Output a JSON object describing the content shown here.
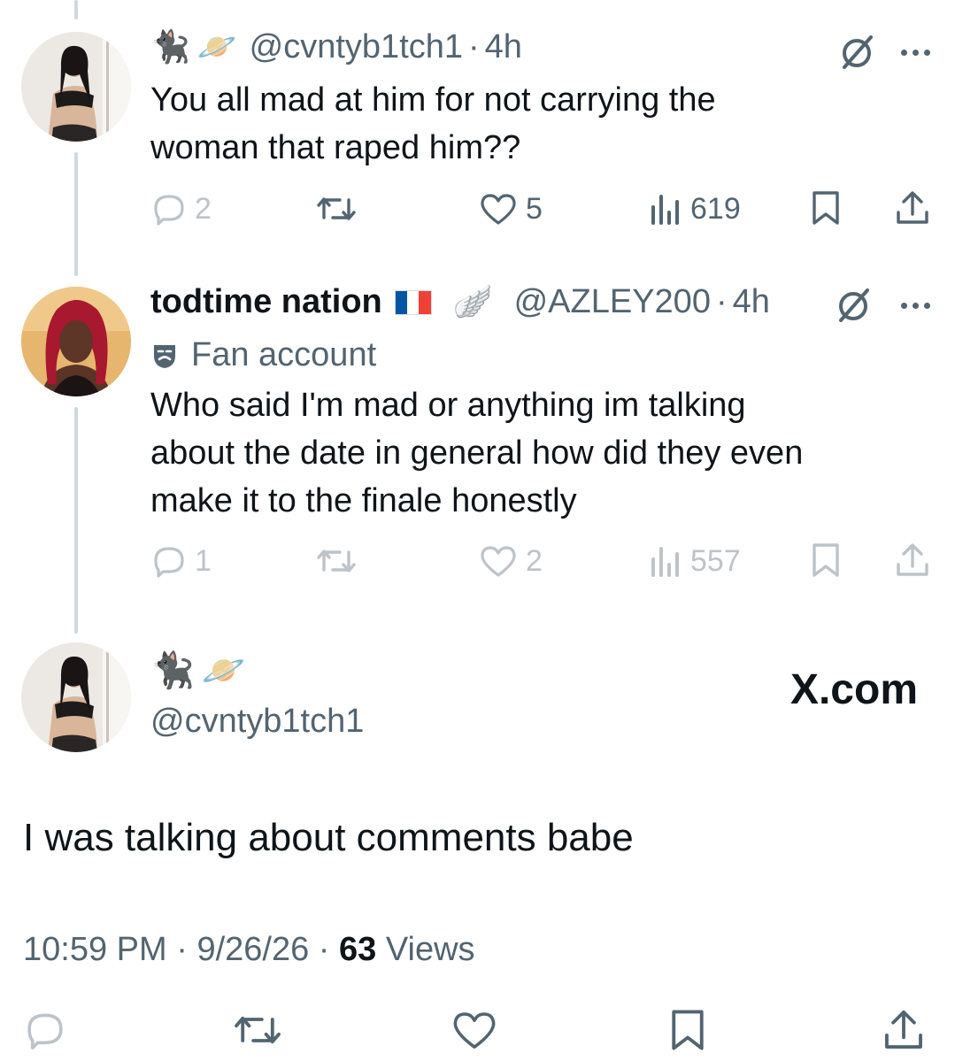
{
  "tweet1": {
    "emojis": [
      "🐈‍⬛",
      "🪐"
    ],
    "handle": "@cvntyb1tch1",
    "separator": "·",
    "time": "4h",
    "text_line1": "You all mad at him for not carrying the",
    "text_line2": "woman that raped him??",
    "replies": "2",
    "likes": "5",
    "views": "619"
  },
  "tweet2": {
    "name": "todtime nation",
    "flag_colors": [
      "#0055a4",
      "#ffffff",
      "#ef4135"
    ],
    "wing": "🪽",
    "handle": "@AZLEY200",
    "separator": "·",
    "time": "4h",
    "label": "Fan account",
    "text_line1": "Who said I'm mad or anything im talking",
    "text_line2": "about the date in general how did they even",
    "text_line3": "make it to the finale honestly",
    "replies": "1",
    "likes": "2",
    "views": "557"
  },
  "main": {
    "emojis": [
      "🐈‍⬛",
      "🪐"
    ],
    "handle": "@cvntyb1tch1",
    "watermark": "X.com",
    "text": "I was talking about comments babe",
    "time": "10:59 PM",
    "sep1": "·",
    "date": "9/26/26",
    "sep2": "·",
    "views_count": "63",
    "views_label": "Views"
  },
  "colors": {
    "text": "#0f1419",
    "secondary": "#536471",
    "thread_line": "#cfd9de"
  }
}
